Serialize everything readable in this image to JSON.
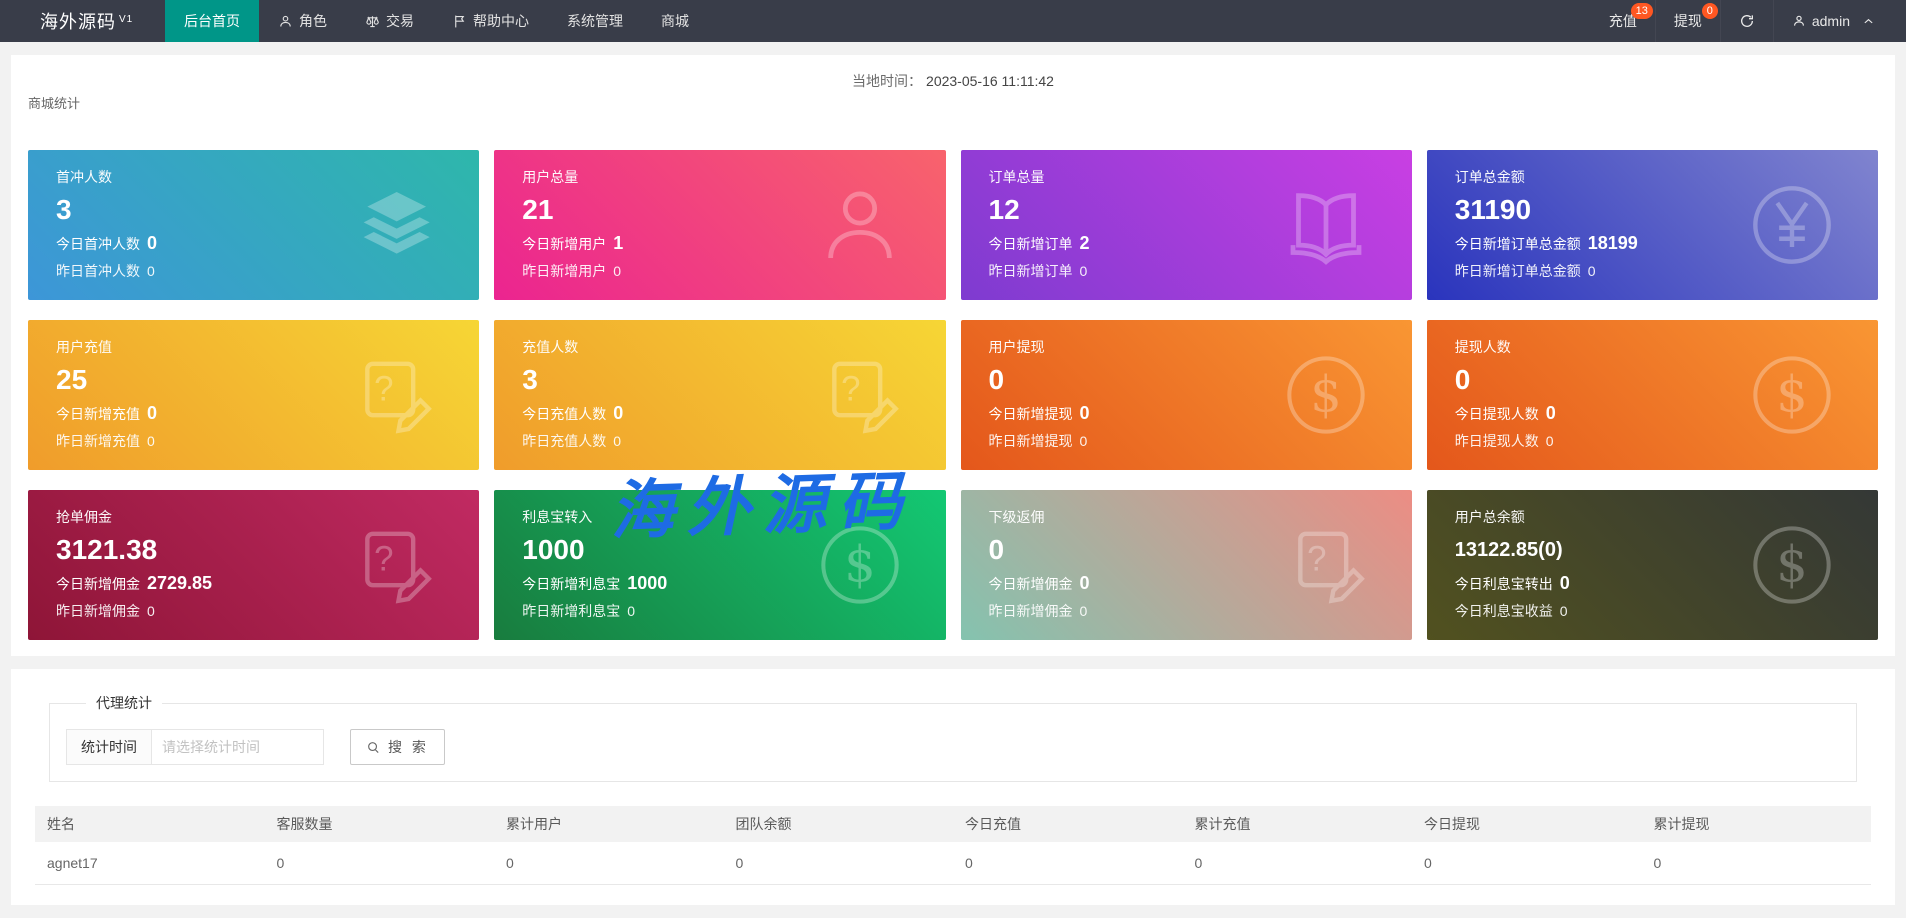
{
  "navbar": {
    "brand": "海外源码",
    "brand_version": "V1",
    "menu": [
      {
        "label": "后台首页",
        "icon": null,
        "active": true
      },
      {
        "label": "角色",
        "icon": "user",
        "active": false
      },
      {
        "label": "交易",
        "icon": "scales",
        "active": false
      },
      {
        "label": "帮助中心",
        "icon": "flag",
        "active": false
      },
      {
        "label": "系统管理",
        "icon": null,
        "active": false
      },
      {
        "label": "商城",
        "icon": null,
        "active": false
      }
    ],
    "right": {
      "recharge": {
        "label": "充值",
        "badge": "13"
      },
      "withdraw": {
        "label": "提现",
        "badge": "0"
      },
      "username": "admin"
    },
    "colors": {
      "bar_bg": "#393d49",
      "active_bg": "#009688",
      "badge_bg": "#ff5722"
    }
  },
  "stats_panel": {
    "local_time_label": "当地时间：",
    "local_time": "2023-05-16 11:11:42",
    "section_title": "商城统计",
    "cards": [
      {
        "title": "首冲人数",
        "value": "3",
        "line1_label": "今日首冲人数",
        "line1_value": "0",
        "line2_label": "昨日首冲人数",
        "line2_value": "0",
        "icon": "layers",
        "gradient": [
          "#3d96d8",
          "#2eb7ab"
        ]
      },
      {
        "title": "用户总量",
        "value": "21",
        "line1_label": "今日新增用户",
        "line1_value": "1",
        "line2_label": "昨日新增用户",
        "line2_value": "0",
        "icon": "person",
        "gradient": [
          "#eb2490",
          "#f8636c"
        ]
      },
      {
        "title": "订单总量",
        "value": "12",
        "line1_label": "今日新增订单",
        "line1_value": "2",
        "line2_label": "昨日新增订单",
        "line2_value": "0",
        "icon": "book",
        "gradient": [
          "#7e3bd0",
          "#c93fe3"
        ]
      },
      {
        "title": "订单总金额",
        "value": "31190",
        "line1_label": "今日新增订单总金额",
        "line1_value": "18199",
        "line2_label": "昨日新增订单总金额",
        "line2_value": "0",
        "icon": "yen",
        "gradient": [
          "#2a34bd",
          "#8084cf"
        ]
      },
      {
        "title": "用户充值",
        "value": "25",
        "line1_label": "今日新增充值",
        "line1_value": "0",
        "line2_label": "昨日新增充值",
        "line2_value": "0",
        "icon": "doc-question",
        "gradient": [
          "#f09c2b",
          "#f6d635"
        ]
      },
      {
        "title": "充值人数",
        "value": "3",
        "line1_label": "今日充值人数",
        "line1_value": "0",
        "line2_label": "昨日充值人数",
        "line2_value": "0",
        "icon": "doc-question",
        "gradient": [
          "#f09c2b",
          "#f6d635"
        ]
      },
      {
        "title": "用户提现",
        "value": "0",
        "line1_label": "今日新增提现",
        "line1_value": "0",
        "line2_label": "昨日新增提现",
        "line2_value": "0",
        "icon": "dollar",
        "gradient": [
          "#e4571b",
          "#f99633"
        ]
      },
      {
        "title": "提现人数",
        "value": "0",
        "line1_label": "今日提现人数",
        "line1_value": "0",
        "line2_label": "昨日提现人数",
        "line2_value": "0",
        "icon": "dollar",
        "gradient": [
          "#e4571b",
          "#f99633"
        ]
      },
      {
        "title": "抢单佣金",
        "value": "3121.38",
        "line1_label": "今日新增佣金",
        "line1_value": "2729.85",
        "line2_label": "昨日新增佣金",
        "line2_value": "0",
        "icon": "doc-question",
        "gradient": [
          "#8e1537",
          "#c12a62"
        ]
      },
      {
        "title": "利息宝转入",
        "value": "1000",
        "line1_label": "今日新增利息宝",
        "line1_value": "1000",
        "line2_label": "昨日新增利息宝",
        "line2_value": "0",
        "icon": "dollar",
        "gradient": [
          "#187c3e",
          "#13c873"
        ]
      },
      {
        "title": "下级返佣",
        "value": "0",
        "line1_label": "今日新增佣金",
        "line1_value": "0",
        "line2_label": "昨日新增佣金",
        "line2_value": "0",
        "icon": "doc-question",
        "gradient": [
          "#84c3af",
          "#ec8d84"
        ]
      },
      {
        "title": "用户总余额",
        "value": "13122.85(0)",
        "line1_label": "今日利息宝转出",
        "line1_value": "0",
        "line2_label": "今日利息宝收益",
        "line2_value": "0",
        "icon": "dollar",
        "gradient": [
          "#51511f",
          "#343836"
        ]
      }
    ]
  },
  "agent_panel": {
    "legend": "代理统计",
    "time_label": "统计时间",
    "time_placeholder": "请选择统计时间",
    "search_label": "搜 索",
    "table": {
      "headers": [
        "姓名",
        "客服数量",
        "累计用户",
        "团队余额",
        "今日充值",
        "累计充值",
        "今日提现",
        "累计提现"
      ],
      "rows": [
        [
          "agnet17",
          "0",
          "0",
          "0",
          "0",
          "0",
          "0",
          "0"
        ]
      ]
    }
  },
  "watermark": "海外源码"
}
